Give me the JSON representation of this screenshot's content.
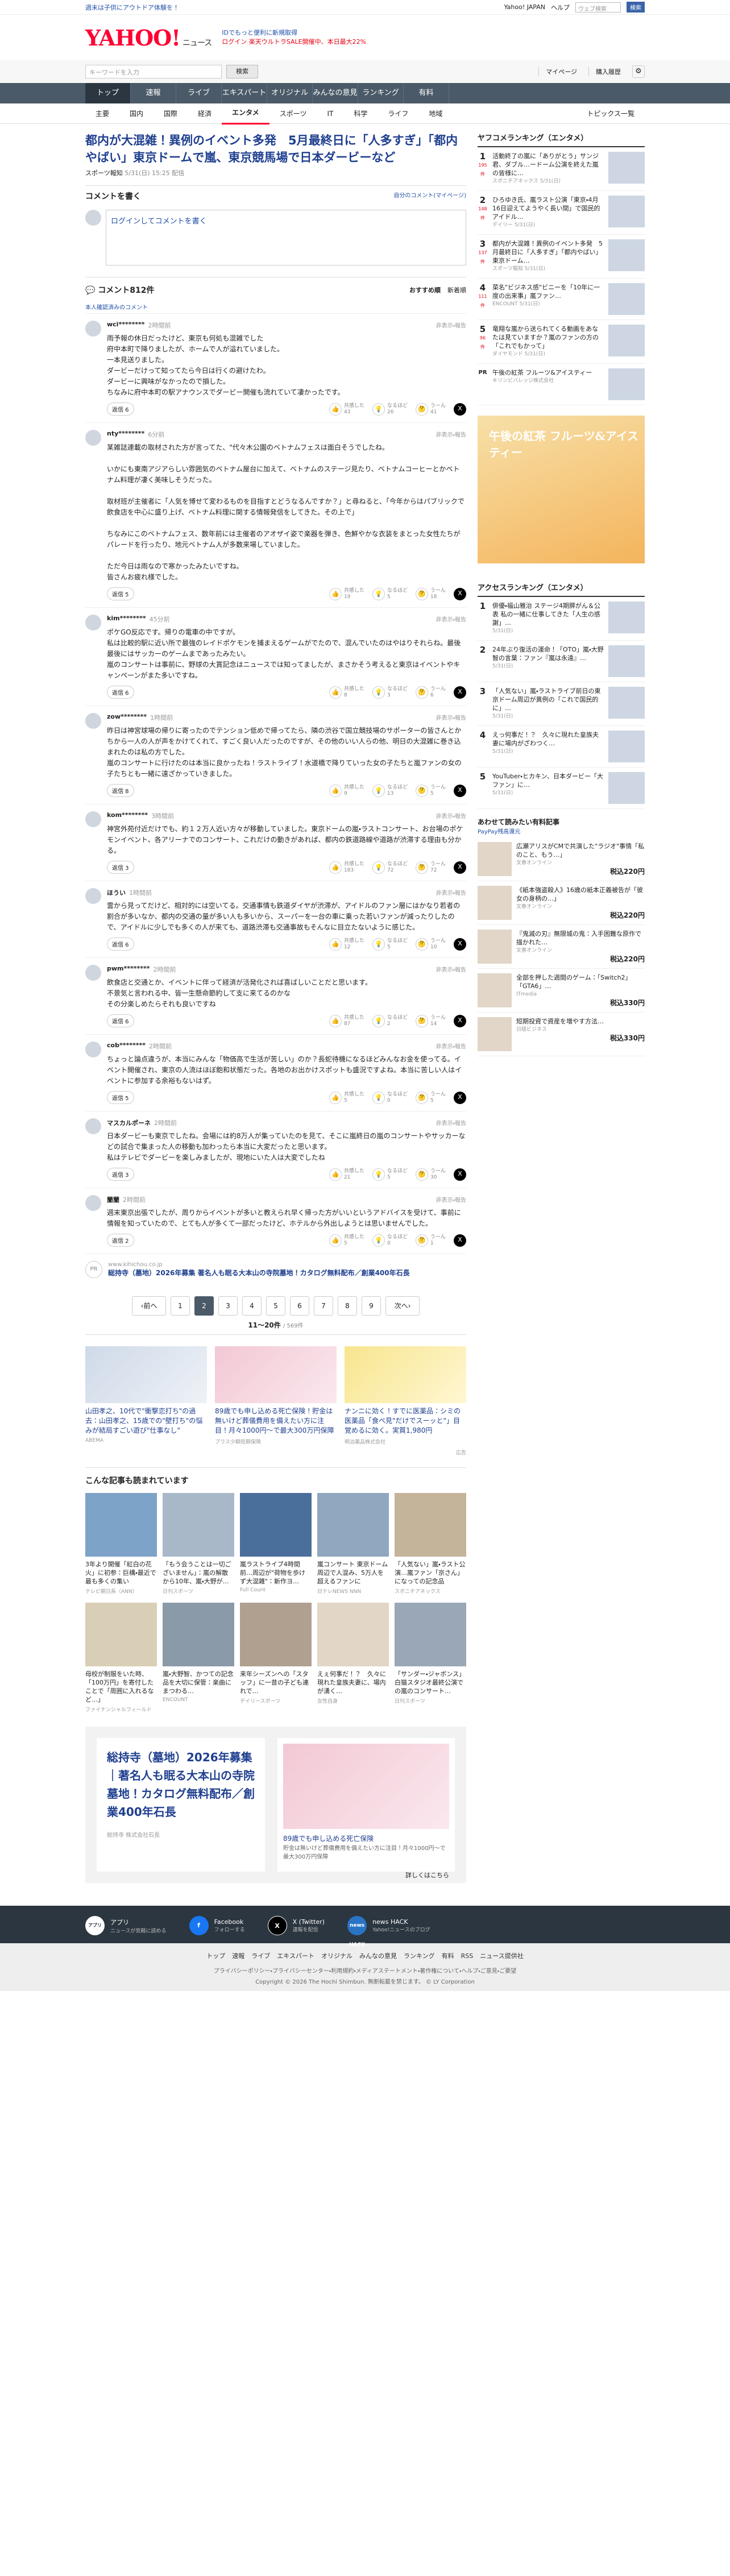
{
  "top": {
    "promo": "週末は子供にアウトドア体験を！",
    "links": [
      "Yahoo! JAPAN",
      "ヘルプ"
    ],
    "search_placeholder": "ウェブ検索",
    "search_button": "検索"
  },
  "header": {
    "logo": "YAHOO!",
    "logo_sub": "ニュース",
    "notice_lines": [
      "IDでもっと便利に新規取得",
      "ログイン 楽天ウルトラSALE開催中、本日最大22%"
    ]
  },
  "searchbar": {
    "placeholder": "キーワードを入力",
    "button": "検索",
    "links": [
      "マイページ",
      "購入履歴"
    ]
  },
  "global_nav": [
    "トップ",
    "速報",
    "ライブ",
    "エキスパート",
    "オリジナル",
    "みんなの意見",
    "ランキング",
    "有料"
  ],
  "sub_nav": [
    "主要",
    "国内",
    "国際",
    "経済",
    "エンタメ",
    "スポーツ",
    "IT",
    "科学",
    "ライフ",
    "地域"
  ],
  "sub_nav_right": "トピックス一覧",
  "article": {
    "title": "都内が大混雑！異例のイベント多発　5月最終日に「人多すぎ」「都内やばい」東京ドームで嵐、東京競馬場で日本ダービーなど",
    "source": "スポーツ報知",
    "date": "5/31(日) 15:25 配信"
  },
  "write_comment": {
    "heading": "コメントを書く",
    "sub": "自分のコメント(マイページ)",
    "placeholder": "ログインしてコメントを書く"
  },
  "comments_head": {
    "count": "コメント812件",
    "sort": [
      "おすすめ順",
      "新着順"
    ],
    "pickup": "本人確認済みのコメント"
  },
  "comments": [
    {
      "user": "wci********",
      "time": "2時間前",
      "text": "雨予報の休日だったけど、東京も何処も混雑でした\n府中本町で降りましたが、ホームで人が溢れていました。\n一本見送りました。\nダービーだけって知ってたら今日は行くの避けたわ。\nダービーに興味がなかったので損した。\nちなみに府中本町の駅アナウンスでダービー開催も流れていて凄かったです。",
      "reply": "返信 6",
      "good": "43",
      "cheer": "26",
      "wrong": "41"
    },
    {
      "user": "nty********",
      "time": "6分前",
      "text": "某雑誌連載の取材された方が言ってた、\"代々木公園のベトナムフェスは面白そうでしたね。\n\nいかにも東南アジアらしい雰囲気のベトナム屋台に加えて、ベトナムのステージ見たり、ベトナムコーヒーとかベトナム料理が凄く美味しそうだった。\n\n取材班が主催者に「人気を博せて変わるものを目指すとどうなるんですか？」と尋ねると、「今年からはパブリックで飲食店を中心に盛り上げ、ベトナム料理に関する情報発信をしてきた。その上で」\n\nちなみにこのベトナムフェス、数年前には主催者のアオザイ姿で楽器を弾き、色鮮やかな衣装をまとった女性たちがパレードを行ったり、地元ベトナム人が多数来場していました。\n\nただ今日は雨なので寒かったみたいですね。\n皆さんお疲れ様でした。",
      "reply": "返信 5",
      "good": "19",
      "cheer": "5",
      "wrong": "18"
    },
    {
      "user": "kim********",
      "time": "45分前",
      "text": "ポケGO反応です。帰りの電車の中ですが。\n私は比較的駅に近い所で最強のレイドポケモンを捕まえるゲームがでたので、混んでいたのはやはりそれらね。最後最後にはサッカーのゲームまであったみたい。\n嵐のコンサートは事前に、野球の大賞記念はニュースでは知ってましたが、まさかそう考えると東京はイベントやキャンペーンがまた多いですね。",
      "reply": "返信 6",
      "good": "8",
      "cheer": "3",
      "wrong": "6"
    },
    {
      "user": "zow********",
      "time": "1時間前",
      "text": "昨日は神宮球場の帰りに寄ったのでテンション低めで帰ってたら、隣の渋谷で国立競技場のサポーターの皆さんとかちから一人の人が声をかけてくれて、すごく良い人だったのですが、その他のいい人らの他、明日の大混雑に巻き込まれたのは私の方でした。\n嵐のコンサートに行けたのは本当に良かったね！ラストライブ！水道橋で降りていった女の子たちと嵐ファンの女の子たちとも一緒に遠ざかっていきました。",
      "reply": "返信 8",
      "good": "9",
      "cheer": "13",
      "wrong": "5"
    },
    {
      "user": "kom********",
      "time": "3時間前",
      "text": "神宮外苑付近だけでも、約１２万人近い方々が移動していました。東京ドームの嵐・ラストコンサート、お台場のポケモンイベント、各アリーナでのコンサート、これだけの動きがあれば、都内の鉄道路線や道路が渋滞する理由も分かる。",
      "reply": "返信 3",
      "good": "183",
      "cheer": "72",
      "wrong": "72"
    },
    {
      "user": "ほうい",
      "time": "1時間前",
      "text": "雲から見ってだけど、相対的には空いてる。交通事情も鉄道ダイヤが渋滞が、アイドルのファン層にはかなり若者の割合が多いなか、都内の交通の量が多い人も多いから、スーパーを一台の車に乗った若いファンが減ったりしたので、アイドルに少しでも多くの人が来ても、道路渋滞も交通事故もそんなに目立たないように感じた。",
      "reply": "返信 6",
      "good": "12",
      "cheer": "5",
      "wrong": "10"
    },
    {
      "user": "pwm********",
      "time": "2時間前",
      "text": "飲食店と交通とか、イベントに伴って経済が活発化されば喜ばしいことだと思います。\n不景気と言われる中、皆一生懸命節約して支に来てるのかな\nその分楽しめたらそれも良いですね",
      "reply": "返信 6",
      "good": "87",
      "cheer": "2",
      "wrong": "14"
    },
    {
      "user": "cob********",
      "time": "2時間前",
      "text": "ちょっと論点違うが、本当にみんな「物価高で生活が苦しい」のか？長蛇待機になるほどみんなお金を使ってる。イベント開催され、東京の人流はほぼ飽和状態だった。各地のお出かけスポットも盛況ですよね。本当に苦しい人はイベントに参加する余裕もないはず。",
      "reply": "返信 5",
      "good": "5",
      "cheer": "0",
      "wrong": "5"
    },
    {
      "user": "マスカルポーネ",
      "time": "2時間前",
      "text": "日本ダービーも東京でしたね。会場には約8万人が集っていたのを見て、そこに嵐終日の嵐のコンサートやサッカーなどの試合で集まった人の移動も加わったら本当に大変だったと思います。\n私はテレビでダービーを楽しみましたが、現地にいた人は大変でしたね",
      "reply": "返信 3",
      "good": "21",
      "cheer": "5",
      "wrong": "30"
    },
    {
      "user": "蘭蘭",
      "time": "2時間前",
      "text": "週末東京出張でしたが、周りからイベントが多いと教えられ早く帰った方がいいというアドバイスを受けて、事前に情報を知っていたので、とても人が多くて一部だったけど、ホテルから外出しようとは思いませんでした。",
      "reply": "返信 2",
      "good": "5",
      "cheer": "0",
      "wrong": "1"
    }
  ],
  "comment_labels": {
    "good": "共感した",
    "cheer": "なるほど",
    "wrong": "うーん",
    "reply_label": "返信",
    "report": "非表示・報告"
  },
  "pr_item": {
    "badge": "PR",
    "domain": "www.kihichou.co.jp",
    "title": "総持寺（墓地）2026年募集 著名人も眠る大本山の寺院墓地！カタログ無料配布／創業400年石長"
  },
  "pager": {
    "prev": "前へ",
    "next": "次へ",
    "pages": [
      "1",
      "2",
      "3",
      "4",
      "5",
      "6",
      "7",
      "8",
      "9"
    ],
    "current": "2",
    "count": "11〜20件",
    "total": "/ 569件"
  },
  "ads": [
    {
      "title": "山田孝之、10代で\"衝撃恋打ち\"の過去：山田孝之、15歳での\"壁打ち\"の悩みが結局すごい遊び\"仕事なし\"",
      "src": "ABEMA"
    },
    {
      "title": "89歳でも申し込める死亡保険！貯金は無いけど葬儀費用を備えたい方に注目！月々1000円〜で最大300万円保障",
      "src": "プラス少額短期保険"
    },
    {
      "title": "ナンニに効く！すでに医薬品：シミの医薬品「食べ見\"だけでスーッと\"」目覚めるに効く。実質1,980円",
      "src": "明治薬品株式会社"
    }
  ],
  "ads_footer": "広告",
  "reco_title": "こんな記事も読まれています",
  "reco": [
    {
      "t": "3年より開催「紅白の花火」に初参：巨構・最近で最も多くの集い",
      "s": "テレビ朝日系（ANN）"
    },
    {
      "t": "「もう会うことは一切ございません」：嵐の解散から10年、嵐・大野が…",
      "s": "日刊スポーツ"
    },
    {
      "t": "嵐ラストライブ4時間前…周辺が\"荷物を歩けず大混雑\"：新作ヨ…",
      "s": "Full Count"
    },
    {
      "t": "嵐コンサート 東京ドーム周辺で人混み、5万人を超えるファンに",
      "s": "日テレNEWS NNN"
    },
    {
      "t": "「人気ない」嵐・ラスト公演…嵐ファン「京さん」になっての記念品",
      "s": "スポニチアネックス"
    },
    {
      "t": "母校が制服をいた時、「100万円」を寄付したことで「周囲に入れるなど…」",
      "s": "ファイナンシャルフィールド"
    },
    {
      "t": "嵐・大野智、かつての記念品を大切に保管：楽曲にまつわる…",
      "s": "ENCOUNT"
    },
    {
      "t": "来年シーズンへの「スタッフ」に一昔の子ども連れで…",
      "s": "デイリースポーツ"
    },
    {
      "t": "えぇ何事だ！？　久々に現れた皇族夫妻に、場内が湧く…",
      "s": "女性自身"
    },
    {
      "t": "「サンダー・ジャボンス」白猫スタジオ最終公演での嵐のコンサート…",
      "s": "日刊スポーツ"
    }
  ],
  "bigad": {
    "title": "総持寺（墓地）2026年募集｜著名人も眠る大本山の寺院墓地！カタログ無料配布／創業400年石長",
    "src": "総持寺 株式会社石長",
    "right_title": "89歳でも申し込める死亡保険",
    "right_sub": "貯金は無いけど葬儀費用を備えたい方に注目！月々1000円〜で最大300万円保障",
    "more": "詳しくはこちら"
  },
  "side": {
    "rank1_title": "ヤフコメランキング（エンタメ）",
    "rank1": [
      {
        "n": "1",
        "c": "195件",
        "t": "活動終了の嵐に「ありがとう」サンジ君、ダブル…ードーム公演を終えた嵐の皆様に…",
        "s": "スポニチアネックス 5/31(日)"
      },
      {
        "n": "2",
        "c": "148件",
        "t": "ひろゆき氏、嵐ラスト公演「東京・4月16日迎えてようやく長い間」で国民的アイドル…",
        "s": "デイリー 5/31(日)"
      },
      {
        "n": "3",
        "c": "137件",
        "t": "都内が大混雑！異例のイベント多発　5月最終日に「人多すぎ」「都内やばい」東京ドーム…",
        "s": "スポーツ報知 5/31(日)"
      },
      {
        "n": "4",
        "c": "111件",
        "t": "菜名\"ビジネス感\"ビニーを「10年に一度の出来事」嵐ファン…",
        "s": "ENCOUNT 5/31(日)"
      },
      {
        "n": "5",
        "c": "96件",
        "t": "竜翔な嵐から送られてくる動画をあなたは見ていますか？嵐のファンの方の「これでもかって」",
        "s": "ダイヤモンド 5/31(日)"
      }
    ],
    "pr_small": "午後の紅茶 フルーツ&アイスティー",
    "pr_small_src": "キリンビバレッジ株式会社",
    "rank2_title": "アクセスランキング（エンタメ）",
    "rank2": [
      {
        "n": "1",
        "t": "俳優・福山雅治 ステージ4期膵がん＆公表 私の一緒に仕事してきた「人生の感謝」…",
        "s": "5/31(日)"
      },
      {
        "n": "2",
        "t": "24年ぶり復活の運命！「OTO」嵐・大野智の言葉：ファン『嵐は永遠』…",
        "s": "5/31(日)"
      },
      {
        "n": "3",
        "t": "「人気ない」嵐・ラストライブ前日の東京ドーム周辺が異例の「これで国民的に」…",
        "s": "5/31(日)"
      },
      {
        "n": "4",
        "t": "えっ何事だ！？　久々に現れた皇族夫妻に場内がざわつく…",
        "s": "5/31(日)"
      },
      {
        "n": "5",
        "t": "YouTuber・ヒカキン、日本ダービー「大ファン」に…",
        "s": "5/31(日)"
      }
    ],
    "pay_title": "あわせて読みたい有料記事",
    "pay_sub": "PayPay残高還元",
    "shop": [
      {
        "t": "広瀬アリスがCMで共演した\"ラジオ\"事情「私のこと、もう…」",
        "s": "文春オンライン",
        "p": "税込220円"
      },
      {
        "t": "《紙本強盗殺人》16歳の紙本正義被告が「彼女の身柄の…」",
        "s": "文春オンライン",
        "p": "税込220円"
      },
      {
        "t": "『鬼滅の刃』無限城の鬼：入手困難な原作で描かれた…",
        "s": "文春オンライン",
        "p": "税込220円"
      },
      {
        "t": "全部を押した週間のゲーム：「Switch2」「GTA6」…",
        "s": "ITmedia",
        "p": "税込330円"
      },
      {
        "t": "短期投資で資産を増やす方法…",
        "s": "日経ビジネス",
        "p": "税込330円"
      }
    ]
  },
  "footer": {
    "items": [
      {
        "icon": "アプリ",
        "label": "アプリ",
        "sub": "ニュースが気軽に読める"
      },
      {
        "icon": "f",
        "label": "Facebook",
        "sub": "フォローする"
      },
      {
        "icon": "X",
        "label": "X (Twitter)",
        "sub": "速報を配信"
      },
      {
        "icon": "news HACK",
        "label": "news HACK",
        "sub": "Yahoo!ニュースのブログ"
      }
    ],
    "nav": [
      "トップ",
      "速報",
      "ライブ",
      "エキスパート",
      "オリジナル",
      "みんなの意見",
      "ランキング",
      "有料",
      "RSS",
      "ニュース提供社"
    ],
    "legal": "プライバシーポリシー・プライバシーセンター・利用規約・メディアステートメント・著作権について・ヘルプ・ご意見・ご要望",
    "copyright": "Copyright © 2026 The Hochi Shimbun. 無断転載を禁じます。 © LY Corporation"
  }
}
